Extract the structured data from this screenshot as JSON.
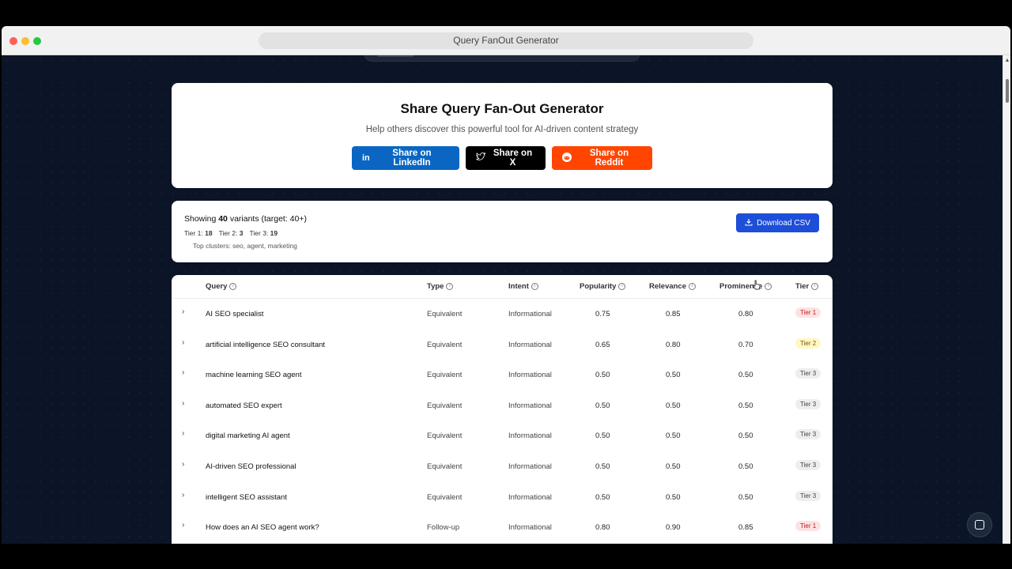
{
  "window": {
    "title": "Query FanOut Generator"
  },
  "share": {
    "title": "Share Query Fan-Out Generator",
    "subtitle": "Help others discover this powerful tool for AI-driven content strategy",
    "linkedin_label": "Share on LinkedIn",
    "x_label": "Share on X",
    "reddit_label": "Share on Reddit",
    "colors": {
      "linkedin": "#0a66c2",
      "x": "#000000",
      "reddit": "#ff4500"
    }
  },
  "summary": {
    "showing_prefix": "Showing",
    "count": "40",
    "showing_suffix": "variants (target: 40+)",
    "tier1_label": "Tier 1:",
    "tier1_count": "18",
    "tier2_label": "Tier 2:",
    "tier2_count": "3",
    "tier3_label": "Tier 3:",
    "tier3_count": "19",
    "clusters": "Top clusters: seo, agent, marketing",
    "download_label": "Download CSV"
  },
  "table": {
    "headers": {
      "query": "Query",
      "type": "Type",
      "intent": "Intent",
      "popularity": "Popularity",
      "relevance": "Relevance",
      "prominence": "Prominence",
      "tier": "Tier"
    },
    "rows": [
      {
        "query": "AI SEO specialist",
        "type": "Equivalent",
        "intent": "Informational",
        "popularity": "0.75",
        "relevance": "0.85",
        "prominence": "0.80",
        "tier": "Tier 1",
        "tier_class": "tier1"
      },
      {
        "query": "artificial intelligence SEO consultant",
        "type": "Equivalent",
        "intent": "Informational",
        "popularity": "0.65",
        "relevance": "0.80",
        "prominence": "0.70",
        "tier": "Tier 2",
        "tier_class": "tier2"
      },
      {
        "query": "machine learning SEO agent",
        "type": "Equivalent",
        "intent": "Informational",
        "popularity": "0.50",
        "relevance": "0.50",
        "prominence": "0.50",
        "tier": "Tier 3",
        "tier_class": "tier3"
      },
      {
        "query": "automated SEO expert",
        "type": "Equivalent",
        "intent": "Informational",
        "popularity": "0.50",
        "relevance": "0.50",
        "prominence": "0.50",
        "tier": "Tier 3",
        "tier_class": "tier3"
      },
      {
        "query": "digital marketing AI agent",
        "type": "Equivalent",
        "intent": "Informational",
        "popularity": "0.50",
        "relevance": "0.50",
        "prominence": "0.50",
        "tier": "Tier 3",
        "tier_class": "tier3"
      },
      {
        "query": "AI-driven SEO professional",
        "type": "Equivalent",
        "intent": "Informational",
        "popularity": "0.50",
        "relevance": "0.50",
        "prominence": "0.50",
        "tier": "Tier 3",
        "tier_class": "tier3"
      },
      {
        "query": "intelligent SEO assistant",
        "type": "Equivalent",
        "intent": "Informational",
        "popularity": "0.50",
        "relevance": "0.50",
        "prominence": "0.50",
        "tier": "Tier 3",
        "tier_class": "tier3"
      },
      {
        "query": "How does an AI SEO agent work?",
        "type": "Follow-up",
        "intent": "Informational",
        "popularity": "0.80",
        "relevance": "0.90",
        "prominence": "0.85",
        "tier": "Tier 1",
        "tier_class": "tier1"
      }
    ]
  },
  "icons": {
    "linkedin": "linkedin-icon",
    "x": "x-icon",
    "reddit": "reddit-icon",
    "download": "download-icon",
    "info": "info-icon",
    "expand": "chevron-right-icon",
    "chat": "chat-icon",
    "scroll_top": "chevron-up-icon"
  }
}
